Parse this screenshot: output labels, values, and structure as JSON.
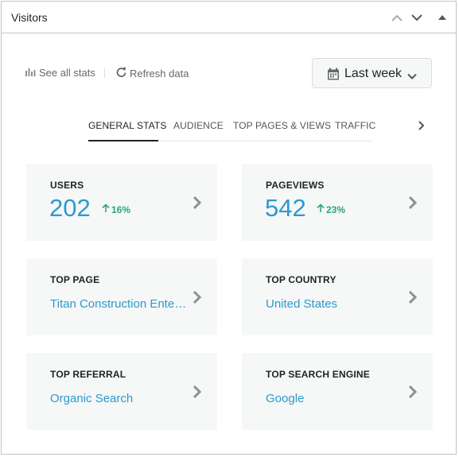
{
  "panel": {
    "title": "Visitors"
  },
  "toolbar": {
    "see_all_stats": "See all stats",
    "refresh_data": "Refresh data",
    "date_range": "Last week"
  },
  "tabs": [
    {
      "label": "GENERAL STATS",
      "active": true
    },
    {
      "label": "AUDIENCE",
      "active": false
    },
    {
      "label": "TOP PAGES & VIEWS",
      "active": false
    },
    {
      "label": "TRAFFIC",
      "active": false
    }
  ],
  "cards": {
    "users": {
      "label": "USERS",
      "value": "202",
      "change": "16%"
    },
    "pageviews": {
      "label": "PAGEVIEWS",
      "value": "542",
      "change": "23%"
    },
    "top_page": {
      "label": "TOP PAGE",
      "value": "Titan Construction Enter…"
    },
    "top_country": {
      "label": "TOP COUNTRY",
      "value": "United States"
    },
    "top_referral": {
      "label": "TOP REFERRAL",
      "value": "Organic Search"
    },
    "top_search_engine": {
      "label": "TOP SEARCH ENGINE",
      "value": "Google"
    }
  },
  "colors": {
    "accent": "#2b9ad0",
    "positive": "#2aa67d",
    "card_bg": "#f6f7f7",
    "muted_text": "#646970"
  },
  "icons": {
    "header": [
      "chevron-up-icon",
      "chevron-down-icon",
      "triangle-up-icon"
    ],
    "toolbar": [
      "bar-chart-icon",
      "refresh-icon",
      "calendar-icon",
      "chevron-down-icon"
    ],
    "cards": [
      "arrow-up-icon",
      "chevron-right-icon"
    ]
  }
}
